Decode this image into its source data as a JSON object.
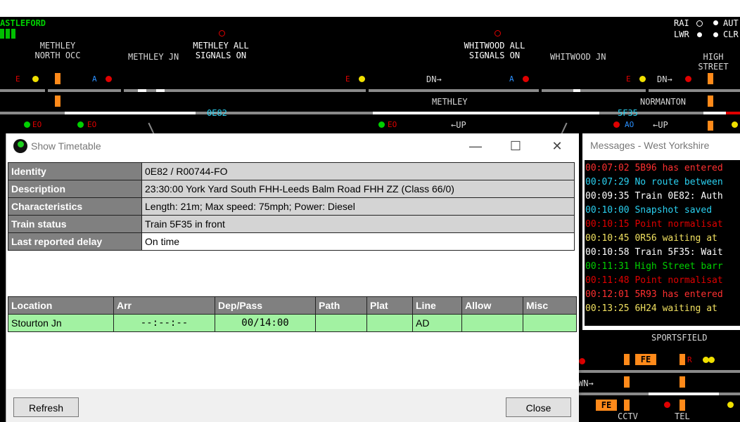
{
  "signalling": {
    "area_name": "ASTLEFORD",
    "labels": {
      "methley_north_occ": [
        "METHLEY",
        "NORTH OCC"
      ],
      "methley_jn": "METHLEY JN",
      "methley_all_signals_on": [
        "METHLEY ALL",
        "SIGNALS ON"
      ],
      "whitwood_all_signals_on": [
        "WHITWOOD ALL",
        "SIGNALS ON"
      ],
      "whitwood_jn": "WHITWOOD JN",
      "high_street": [
        "HIGH",
        "STREET"
      ],
      "methley": "METHLEY",
      "normanton": "NORMANTON",
      "sportsfield": "SPORTSFIELD",
      "cctv": "CCTV",
      "tel": "TEL",
      "rai": "RAI",
      "lwr": "LWR",
      "aut": "AUT",
      "clr": "CLR",
      "dn": "DN",
      "up": "UP",
      "fe": "FE",
      "wn": "WN"
    },
    "train_berths": [
      "0E82",
      "5F35"
    ],
    "signal_codes": [
      "E",
      "A",
      "EO",
      "AO",
      "R",
      "FE"
    ],
    "colors": {
      "track": "#8a8a8a",
      "route": "#ffffff",
      "occupied": "#e00000",
      "block": "#ff8a1a",
      "text": "#d8d8d8"
    }
  },
  "timetable_window": {
    "title": "Show Timetable",
    "controls": {
      "minimize": "—",
      "maximize": "☐",
      "close": "✕"
    },
    "info": [
      {
        "key": "Identity",
        "value": "0E82 / R00744-FO"
      },
      {
        "key": "Description",
        "value": "23:30:00 York Yard South FHH-Leeds Balm Road FHH ZZ (Class 66/0)"
      },
      {
        "key": "Characteristics",
        "value": "Length: 21m; Max speed: 75mph; Power: Diesel"
      },
      {
        "key": "Train status",
        "value": "Train 5F35 in front"
      },
      {
        "key": "Last reported delay",
        "value": "On time"
      }
    ],
    "columns": [
      "Location",
      "Arr",
      "Dep/Pass",
      "Path",
      "Plat",
      "Line",
      "Allow",
      "Misc"
    ],
    "rows": [
      {
        "location": "Stourton Jn",
        "arr": "--:--:--",
        "dep": "00/14:00",
        "path": "",
        "plat": "",
        "line": "AD",
        "allow": "",
        "misc": ""
      }
    ],
    "buttons": {
      "refresh": "Refresh",
      "close": "Close"
    },
    "colors": {
      "header": "#808080",
      "row": "#a2f2a2",
      "value_bg": "#d4d4d4"
    }
  },
  "messages_window": {
    "title": "Messages - West Yorkshire",
    "messages": [
      {
        "time": "00:07:02",
        "text": "5B96 has entered",
        "color": "#ff3030"
      },
      {
        "time": "00:07:29",
        "text": "No route between",
        "color": "#2ad0f0"
      },
      {
        "time": "00:09:35",
        "text": "Train 0E82: Auth",
        "color": "#ffffff"
      },
      {
        "time": "00:10:00",
        "text": "Snapshot saved",
        "color": "#2ad0f0"
      },
      {
        "time": "00:10:15",
        "text": "Point normalisat",
        "color": "#e00000"
      },
      {
        "time": "00:10:45",
        "text": "0R56 waiting at",
        "color": "#f0e060"
      },
      {
        "time": "00:10:58",
        "text": "Train 5F35: Wait",
        "color": "#ffffff"
      },
      {
        "time": "00:11:31",
        "text": "High Street barr",
        "color": "#00d000"
      },
      {
        "time": "00:11:48",
        "text": "Point normalisat",
        "color": "#e00000"
      },
      {
        "time": "00:12:01",
        "text": "5R93 has entered",
        "color": "#ff3030"
      },
      {
        "time": "00:13:25",
        "text": "6H24 waiting at",
        "color": "#f0e060"
      }
    ]
  }
}
